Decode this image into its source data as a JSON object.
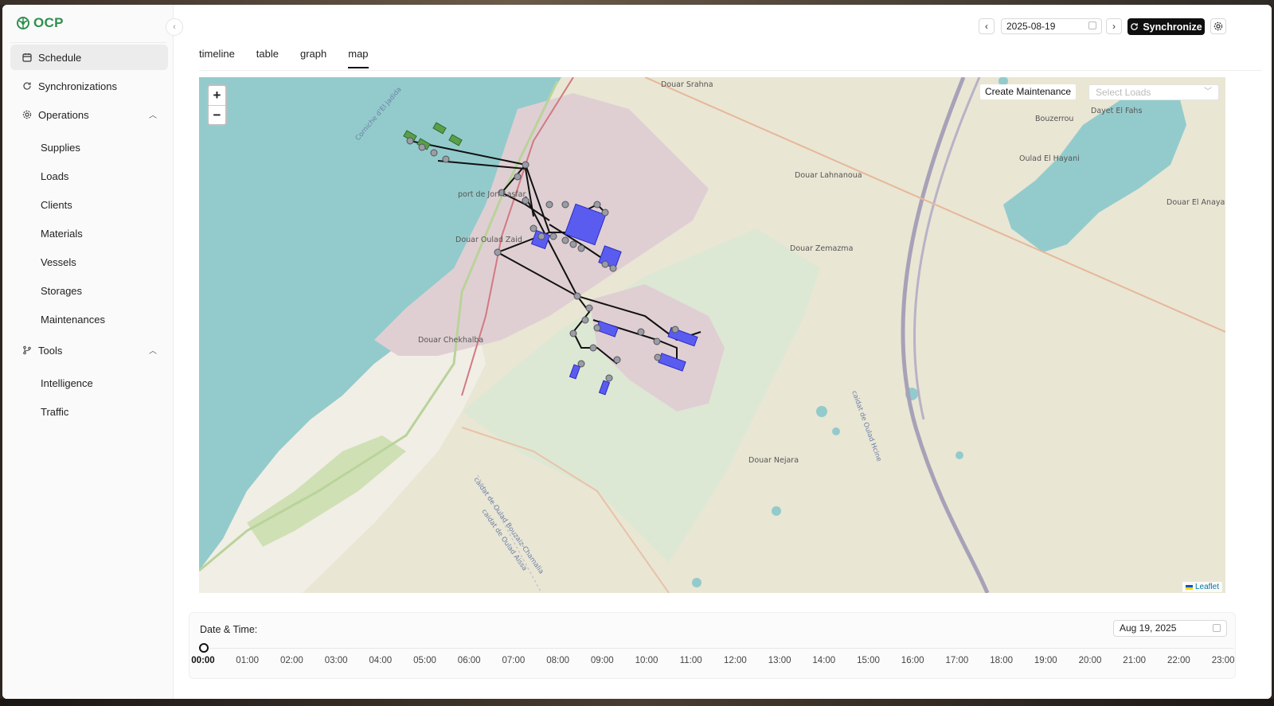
{
  "brand": {
    "name": "OCP",
    "logo_color": "#2f8f4e"
  },
  "sidebar": {
    "items": [
      {
        "label": "Schedule",
        "icon": "calendar-icon",
        "active": true
      },
      {
        "label": "Synchronizations",
        "icon": "refresh-icon"
      },
      {
        "label": "Operations",
        "icon": "gear-icon",
        "expanded": true
      }
    ],
    "operations": [
      "Supplies",
      "Loads",
      "Clients",
      "Materials",
      "Vessels",
      "Storages",
      "Maintenances"
    ],
    "tools_label": "Tools",
    "tools": [
      "Intelligence",
      "Traffic"
    ]
  },
  "header": {
    "date": "2025-08-19",
    "sync_label": "Synchronize"
  },
  "tabs": [
    {
      "label": "timeline"
    },
    {
      "label": "table"
    },
    {
      "label": "graph"
    },
    {
      "label": "map",
      "active": true
    }
  ],
  "map": {
    "create_maintenance_label": "Create Maintenance",
    "select_loads_placeholder": "Select Loads",
    "attribution": "Leaflet",
    "place_labels": [
      "Douar Srahna",
      "Douar Lahnanoua",
      "Douar Zemazma",
      "Oulad El Hayani",
      "Douar El Anayat",
      "El Fahs",
      "port de Jorf Lasfar",
      "Douar Oulad Zaid",
      "Douar Chekhalba",
      "Douar Nejara",
      "Bouzerrou",
      "Dayet El Fahs"
    ],
    "road_labels": [
      "Corniche d'El Jadida",
      "caidat de Oulad Bouzaiz-Chamalia",
      "caidat de Oulad Aissa",
      "caidat de Oulad Hcine"
    ],
    "colors": {
      "sea": "#93cbcc",
      "land": "#e9e6d4",
      "industrial": "#dfcfd3",
      "facility": "#5a5cf0"
    }
  },
  "timeline": {
    "label": "Date & Time:",
    "date": "Aug 19, 2025",
    "ticks": [
      "00:00",
      "01:00",
      "02:00",
      "03:00",
      "04:00",
      "05:00",
      "06:00",
      "07:00",
      "08:00",
      "09:00",
      "10:00",
      "11:00",
      "12:00",
      "13:00",
      "14:00",
      "15:00",
      "16:00",
      "17:00",
      "18:00",
      "19:00",
      "20:00",
      "21:00",
      "22:00",
      "23:00"
    ],
    "selected": "00:00"
  }
}
